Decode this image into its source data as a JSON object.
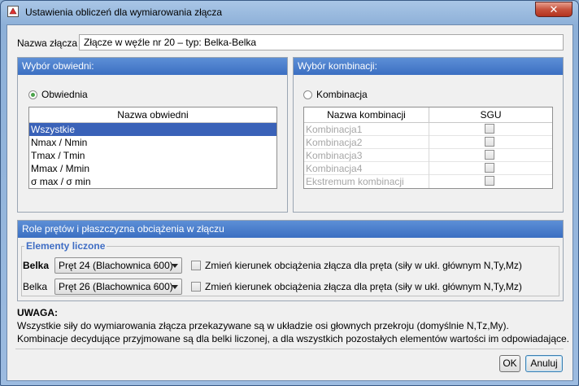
{
  "window": {
    "title": "Ustawienia obliczeń dla wymiarowania złącza",
    "close_label": "✕"
  },
  "connection": {
    "label": "Nazwa złącza",
    "value": "Złącze w węźle nr 20 – typ: Belka-Belka"
  },
  "envelope_panel": {
    "header": "Wybór obwiedni:",
    "radio_label": "Obwiednia",
    "column": "Nazwa obwiedni",
    "rows": [
      "Wszystkie",
      "Nmax / Nmin",
      "Tmax / Tmin",
      "Mmax / Mmin",
      "σ max / σ min"
    ],
    "selected_index": 0
  },
  "combination_panel": {
    "header": "Wybór kombinacji:",
    "radio_label": "Kombinacja",
    "columns": [
      "Nazwa kombinacji",
      "SGU"
    ],
    "rows": [
      "Kombinacja1",
      "Kombinacja2",
      "Kombinacja3",
      "Kombinacja4",
      "Ekstremum kombinacji"
    ]
  },
  "roles_panel": {
    "header": "Role prętów i płaszczyzna obciążenia w złączu",
    "group_title": "Elementy liczone",
    "rows": [
      {
        "role": "Belka",
        "element": "Pręt 24 (Blachownica 600)",
        "checkbox_label": "Zmień kierunek obciążenia złącza dla pręta (siły w ukł. głównym N,Ty,Mz)"
      },
      {
        "role": "Belka",
        "element": "Pręt 26 (Blachownica 600)",
        "checkbox_label": "Zmień kierunek obciążenia złącza dla pręta (siły w ukł. głównym N,Ty,Mz)"
      }
    ]
  },
  "note": {
    "title": "UWAGA:",
    "line1": "Wszystkie siły do wymiarowania złącza przekazywane są w układzie osi głownych przekroju (domyślnie N,Tz,My).",
    "line2": "Kombinacje decydujące przyjmowane są dla belki liczonej, a dla wszystkich pozostałych elementów wartości im odpowiadające."
  },
  "buttons": {
    "ok": "OK",
    "cancel": "Anuluj"
  }
}
